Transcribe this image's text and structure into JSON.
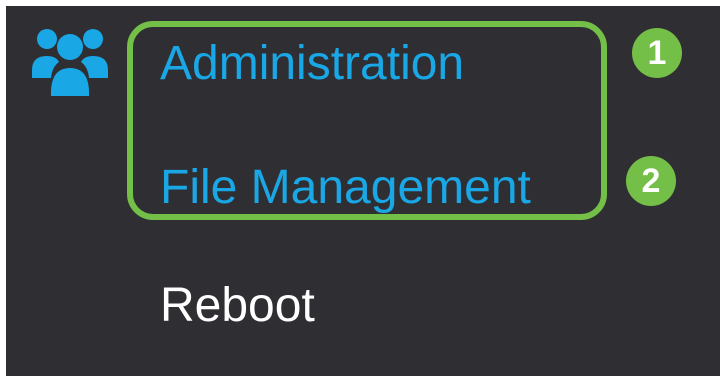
{
  "colors": {
    "background": "#2f2e33",
    "accent": "#19a7e6",
    "text_white": "#ffffff",
    "callout_green": "#74bf47"
  },
  "section": {
    "icon": "people-group-icon"
  },
  "menu": {
    "items": [
      {
        "label": "Administration",
        "state": "highlighted"
      },
      {
        "label": "File Management",
        "state": "highlighted"
      },
      {
        "label": "Reboot",
        "state": "normal"
      }
    ]
  },
  "callouts": [
    {
      "number": "1"
    },
    {
      "number": "2"
    }
  ]
}
